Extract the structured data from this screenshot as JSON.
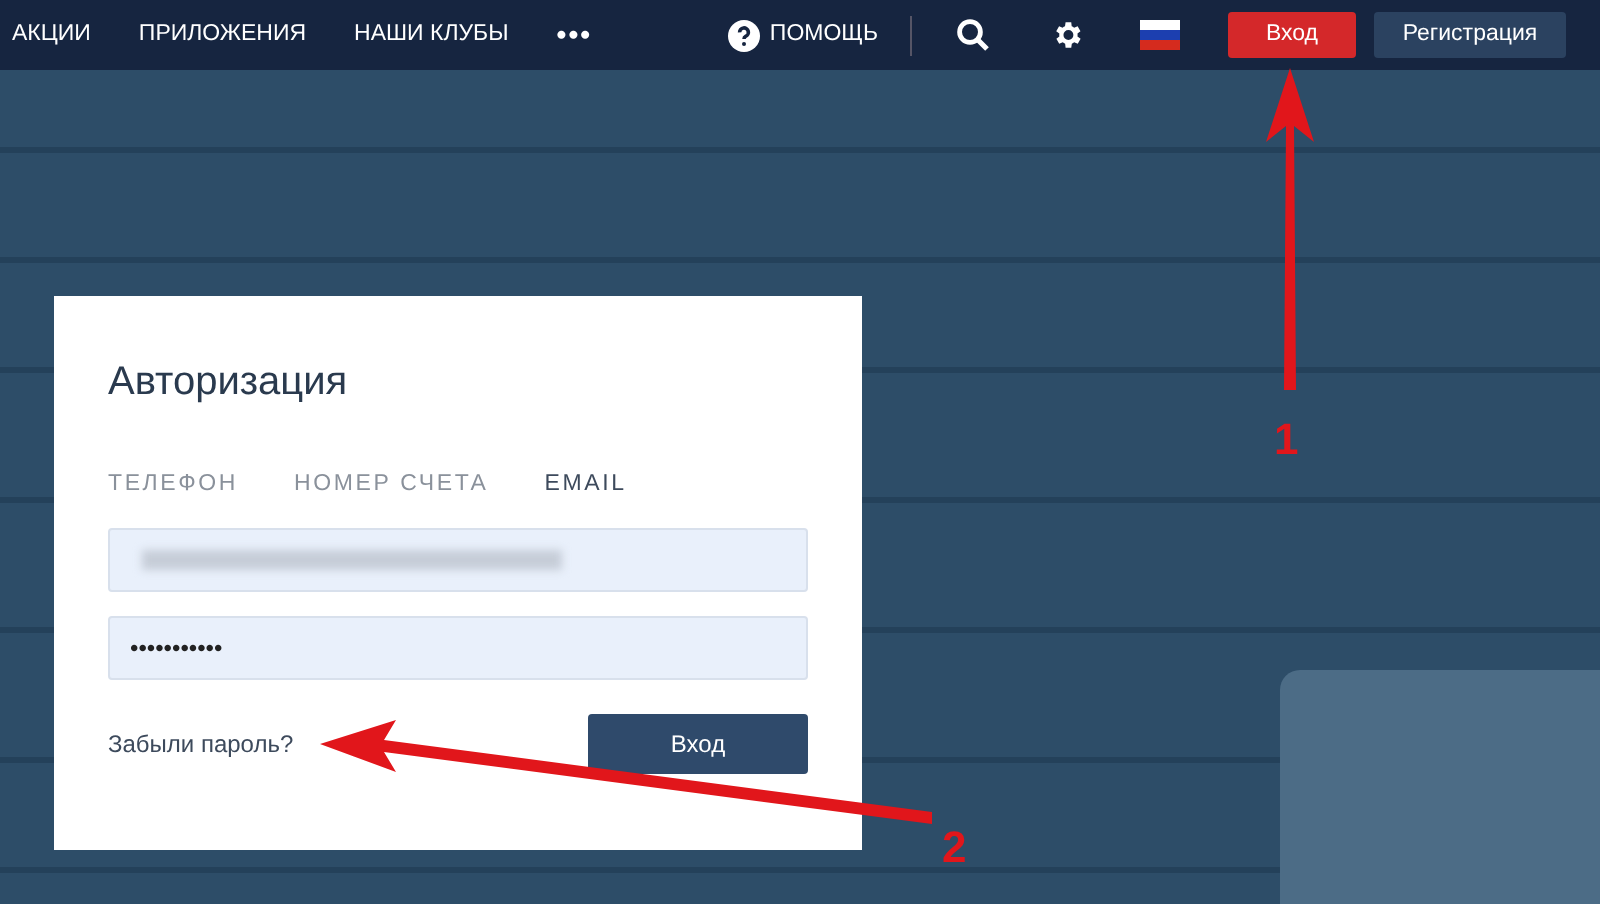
{
  "nav": {
    "items": [
      "АКЦИИ",
      "ПРИЛОЖЕНИЯ",
      "НАШИ КЛУБЫ"
    ],
    "more": "•••",
    "help": "ПОМОЩЬ",
    "login": "Вход",
    "register": "Регистрация"
  },
  "login_card": {
    "title": "Авторизация",
    "tabs": [
      {
        "label": "ТЕЛЕФОН",
        "selected": false
      },
      {
        "label": "НОМЕР СЧЕТА",
        "selected": false
      },
      {
        "label": "EMAIL",
        "selected": true
      }
    ],
    "password": "•••••••••••",
    "forgot": "Забыли пароль?",
    "submit": "Вход"
  },
  "annotations": [
    {
      "label": "1"
    },
    {
      "label": "2"
    }
  ]
}
